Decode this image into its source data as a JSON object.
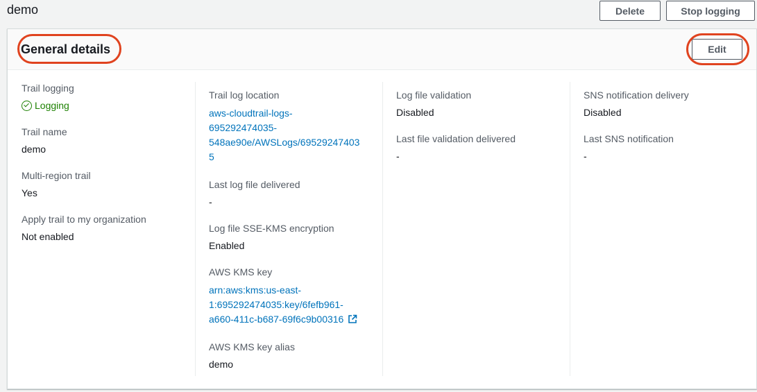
{
  "page": {
    "title": "demo"
  },
  "actions": {
    "delete_label": "Delete",
    "stop_logging_label": "Stop logging"
  },
  "panel": {
    "title": "General details",
    "edit_label": "Edit"
  },
  "col1": {
    "trail_logging_label": "Trail logging",
    "trail_logging_value": "Logging",
    "trail_name_label": "Trail name",
    "trail_name_value": "demo",
    "multi_region_label": "Multi-region trail",
    "multi_region_value": "Yes",
    "apply_org_label": "Apply trail to my organization",
    "apply_org_value": "Not enabled"
  },
  "col2": {
    "log_location_label": "Trail log location",
    "log_location_line1": "aws-cloudtrail-logs-",
    "log_location_line2": "695292474035-",
    "log_location_line3": "548ae90e/AWSLogs/69529247403",
    "log_location_line4": "5",
    "last_delivered_label": "Last log file delivered",
    "last_delivered_value": "-",
    "sse_kms_label": "Log file SSE-KMS encryption",
    "sse_kms_value": "Enabled",
    "kms_key_label": "AWS KMS key",
    "kms_key_line1": "arn:aws:kms:us-east-",
    "kms_key_line2": "1:695292474035:key/6fefb961-",
    "kms_key_line3": "a660-411c-b687-69f6c9b00316",
    "kms_alias_label": "AWS KMS key alias",
    "kms_alias_value": "demo"
  },
  "col3": {
    "validation_label": "Log file validation",
    "validation_value": "Disabled",
    "last_validation_label": "Last file validation delivered",
    "last_validation_value": "-"
  },
  "col4": {
    "sns_delivery_label": "SNS notification delivery",
    "sns_delivery_value": "Disabled",
    "last_sns_label": "Last SNS notification",
    "last_sns_value": "-"
  },
  "icons": {
    "status": "check-circle-icon",
    "external": "external-link-icon"
  },
  "colors": {
    "link": "#0073bb",
    "success": "#1d8102",
    "highlight_ring": "#e0431f"
  }
}
